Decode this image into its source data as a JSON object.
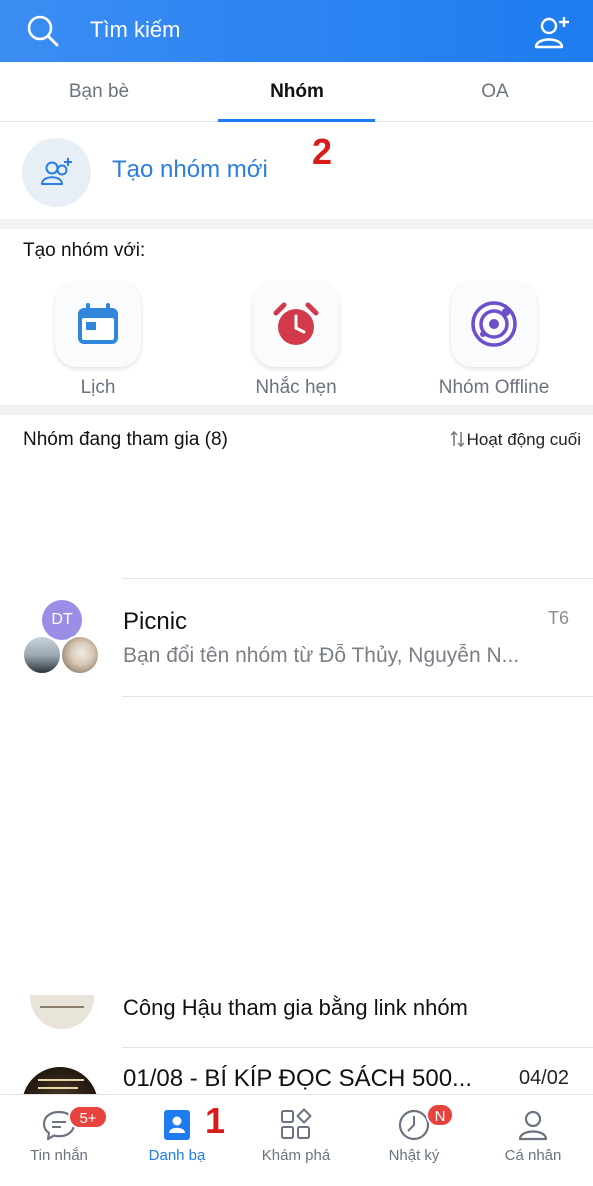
{
  "colors": {
    "accent": "#1e7cf0",
    "annotation": "#d81b1b",
    "badge": "#e8423f"
  },
  "header": {
    "search_placeholder": "Tìm kiếm",
    "search_icon": "search-icon",
    "add_friend_icon": "add-friend-icon"
  },
  "tabs": [
    {
      "label": "Bạn bè",
      "active": false
    },
    {
      "label": "Nhóm",
      "active": true
    },
    {
      "label": "OA",
      "active": false
    }
  ],
  "create_group": {
    "label": "Tạo nhóm mới",
    "icon": "add-group-icon"
  },
  "annotations": {
    "step1": "1",
    "step2": "2"
  },
  "quick_create": {
    "title": "Tạo nhóm với:",
    "items": [
      {
        "label": "Lịch",
        "icon": "calendar-icon"
      },
      {
        "label": "Nhắc hẹn",
        "icon": "alarm-clock-icon"
      },
      {
        "label": "Nhóm Offline",
        "icon": "radar-icon"
      }
    ]
  },
  "groups": {
    "title": "Nhóm đang tham gia (8)",
    "sort_label": "Hoạt động cuối",
    "sort_icon": "sort-icon",
    "items": [
      {
        "initials": "DT",
        "name": "Picnic",
        "time": "T6",
        "last_message": "Bạn đổi tên nhóm từ Đỗ Thủy, Nguyễn N..."
      }
    ],
    "partial_items": [
      {
        "last_message": "Công Hậu tham gia bằng link nhóm"
      },
      {
        "name": "01/08 - BÍ KÍP ĐỌC SÁCH 500...",
        "time": "04/02"
      }
    ]
  },
  "bottom_nav": [
    {
      "label": "Tin nhắn",
      "icon": "chat-icon",
      "badge": "5+",
      "active": false
    },
    {
      "label": "Danh bạ",
      "icon": "contacts-icon",
      "badge": "",
      "active": true
    },
    {
      "label": "Khám phá",
      "icon": "discover-icon",
      "badge": "",
      "active": false
    },
    {
      "label": "Nhật ký",
      "icon": "clock-icon",
      "badge": "N",
      "active": false
    },
    {
      "label": "Cá nhân",
      "icon": "profile-icon",
      "badge": "",
      "active": false
    }
  ]
}
